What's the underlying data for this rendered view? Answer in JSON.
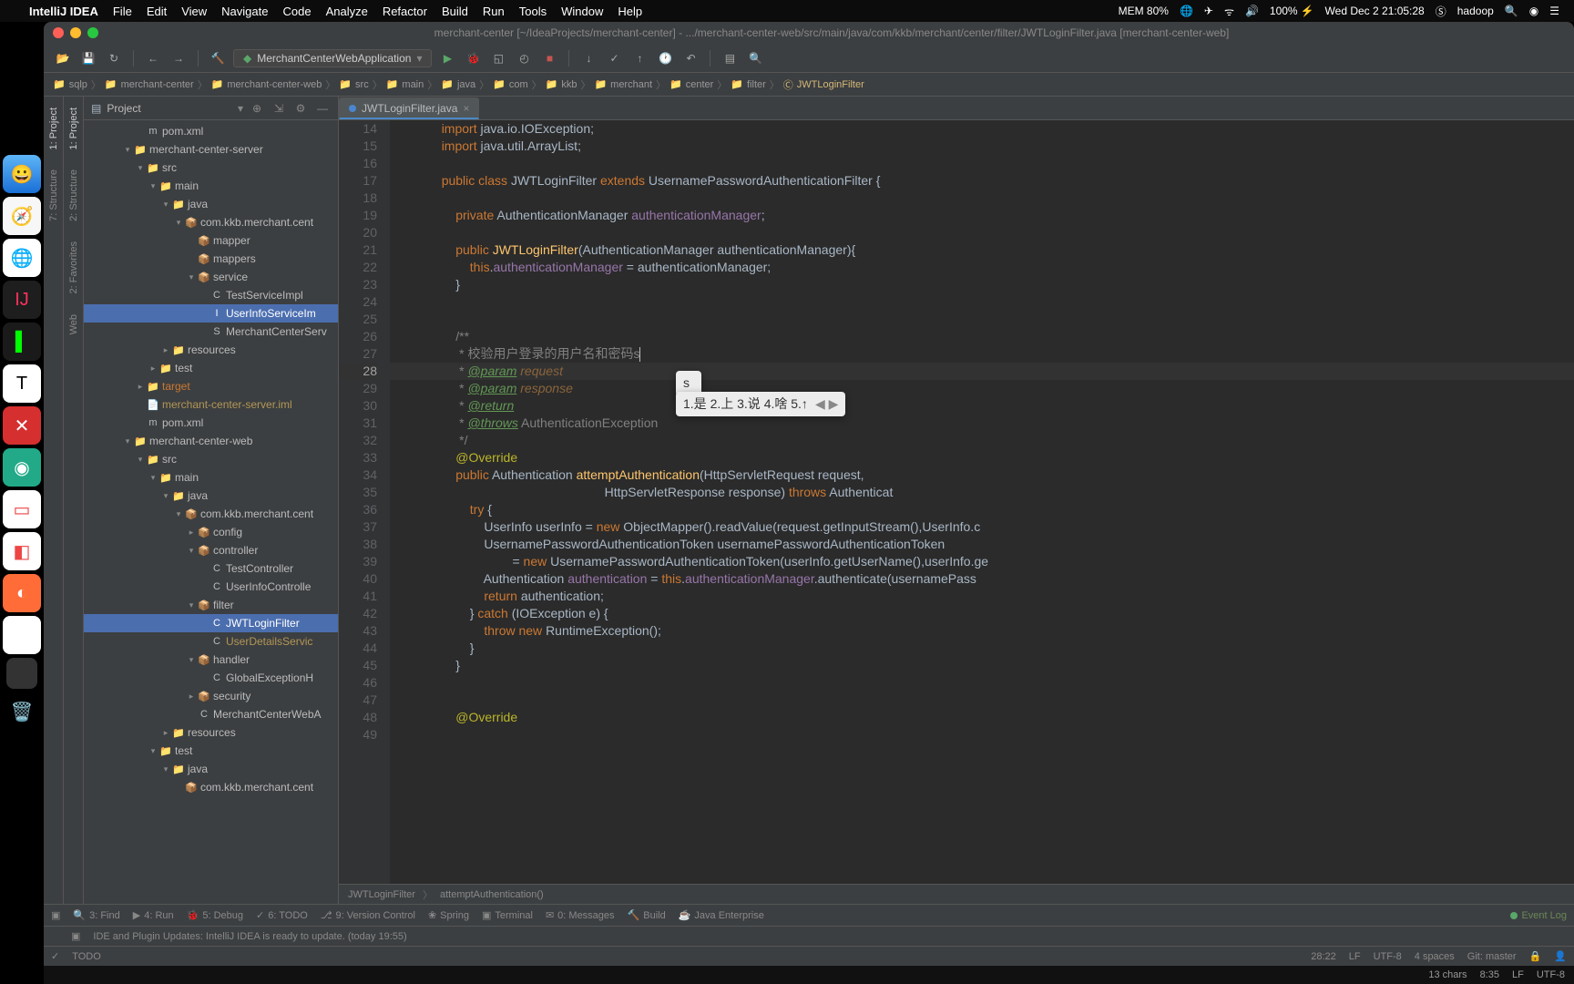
{
  "menubar": {
    "app": "IntelliJ IDEA",
    "items": [
      "File",
      "Edit",
      "View",
      "Navigate",
      "Code",
      "Analyze",
      "Refactor",
      "Build",
      "Run",
      "Tools",
      "Window",
      "Help"
    ],
    "status": {
      "mem": "MEM 80%",
      "battery": "100%",
      "date": "Wed Dec 2  21:05:28",
      "user": "hadoop"
    }
  },
  "window": {
    "title": "merchant-center [~/IdeaProjects/merchant-center] - .../merchant-center-web/src/main/java/com/kkb/merchant/center/filter/JWTLoginFilter.java [merchant-center-web]"
  },
  "toolbar": {
    "run_config": "MerchantCenterWebApplication"
  },
  "breadcrumb": [
    "sqlp",
    "merchant-center",
    "merchant-center-web",
    "src",
    "main",
    "java",
    "com",
    "kkb",
    "merchant",
    "center",
    "filter",
    "JWTLoginFilter"
  ],
  "project_panel": {
    "title": "Project"
  },
  "tree": [
    {
      "d": 4,
      "a": "",
      "i": "m",
      "t": "pom.xml",
      "cls": ""
    },
    {
      "d": 3,
      "a": "▾",
      "i": "📁",
      "t": "merchant-center-server",
      "cls": ""
    },
    {
      "d": 4,
      "a": "▾",
      "i": "📁",
      "t": "src",
      "cls": ""
    },
    {
      "d": 5,
      "a": "▾",
      "i": "📁",
      "t": "main",
      "cls": ""
    },
    {
      "d": 6,
      "a": "▾",
      "i": "📁",
      "t": "java",
      "cls": ""
    },
    {
      "d": 7,
      "a": "▾",
      "i": "📦",
      "t": "com.kkb.merchant.cent",
      "cls": ""
    },
    {
      "d": 8,
      "a": "",
      "i": "📦",
      "t": "mapper",
      "cls": ""
    },
    {
      "d": 8,
      "a": "",
      "i": "📦",
      "t": "mappers",
      "cls": ""
    },
    {
      "d": 8,
      "a": "▾",
      "i": "📦",
      "t": "service",
      "cls": ""
    },
    {
      "d": 9,
      "a": "",
      "i": "C",
      "t": "TestServiceImpl",
      "cls": ""
    },
    {
      "d": 9,
      "a": "",
      "i": "I",
      "t": "UserInfoServiceIm",
      "cls": "selected"
    },
    {
      "d": 9,
      "a": "",
      "i": "S",
      "t": "MerchantCenterServ",
      "cls": ""
    },
    {
      "d": 6,
      "a": "▸",
      "i": "📁",
      "t": "resources",
      "cls": ""
    },
    {
      "d": 5,
      "a": "▸",
      "i": "📁",
      "t": "test",
      "cls": ""
    },
    {
      "d": 4,
      "a": "▸",
      "i": "📁",
      "t": "target",
      "cls": "orange"
    },
    {
      "d": 4,
      "a": "",
      "i": "📄",
      "t": "merchant-center-server.iml",
      "cls": "yellow"
    },
    {
      "d": 4,
      "a": "",
      "i": "m",
      "t": "pom.xml",
      "cls": ""
    },
    {
      "d": 3,
      "a": "▾",
      "i": "📁",
      "t": "merchant-center-web",
      "cls": ""
    },
    {
      "d": 4,
      "a": "▾",
      "i": "📁",
      "t": "src",
      "cls": ""
    },
    {
      "d": 5,
      "a": "▾",
      "i": "📁",
      "t": "main",
      "cls": ""
    },
    {
      "d": 6,
      "a": "▾",
      "i": "📁",
      "t": "java",
      "cls": ""
    },
    {
      "d": 7,
      "a": "▾",
      "i": "📦",
      "t": "com.kkb.merchant.cent",
      "cls": ""
    },
    {
      "d": 8,
      "a": "▸",
      "i": "📦",
      "t": "config",
      "cls": ""
    },
    {
      "d": 8,
      "a": "▾",
      "i": "📦",
      "t": "controller",
      "cls": ""
    },
    {
      "d": 9,
      "a": "",
      "i": "C",
      "t": "TestController",
      "cls": ""
    },
    {
      "d": 9,
      "a": "",
      "i": "C",
      "t": "UserInfoControlle",
      "cls": ""
    },
    {
      "d": 8,
      "a": "▾",
      "i": "📦",
      "t": "filter",
      "cls": ""
    },
    {
      "d": 9,
      "a": "",
      "i": "C",
      "t": "JWTLoginFilter",
      "cls": "selected"
    },
    {
      "d": 9,
      "a": "",
      "i": "C",
      "t": "UserDetailsServic",
      "cls": "yellow"
    },
    {
      "d": 8,
      "a": "▾",
      "i": "📦",
      "t": "handler",
      "cls": ""
    },
    {
      "d": 9,
      "a": "",
      "i": "C",
      "t": "GlobalExceptionH",
      "cls": ""
    },
    {
      "d": 8,
      "a": "▸",
      "i": "📦",
      "t": "security",
      "cls": ""
    },
    {
      "d": 8,
      "a": "",
      "i": "C",
      "t": "MerchantCenterWebA",
      "cls": ""
    },
    {
      "d": 6,
      "a": "▸",
      "i": "📁",
      "t": "resources",
      "cls": ""
    },
    {
      "d": 5,
      "a": "▾",
      "i": "📁",
      "t": "test",
      "cls": ""
    },
    {
      "d": 6,
      "a": "▾",
      "i": "📁",
      "t": "java",
      "cls": ""
    },
    {
      "d": 7,
      "a": "",
      "i": "📦",
      "t": "com.kkb.merchant.cent",
      "cls": ""
    }
  ],
  "editor_tab": "JWTLoginFilter.java",
  "line_start": 14,
  "line_count": 36,
  "highlight_line": 28,
  "code_lines": [
    {
      "tokens": [
        [
          "",
          "            "
        ],
        [
          "kw",
          "import"
        ],
        [
          "",
          " java.io.IOException;"
        ]
      ]
    },
    {
      "tokens": [
        [
          "",
          "            "
        ],
        [
          "kw",
          "import"
        ],
        [
          "",
          " java.util.ArrayList;"
        ]
      ]
    },
    {
      "tokens": [
        [
          "",
          ""
        ]
      ]
    },
    {
      "tokens": [
        [
          "",
          "            "
        ],
        [
          "kw",
          "public class "
        ],
        [
          "cls",
          "JWTLoginFilter "
        ],
        [
          "kw",
          "extends "
        ],
        [
          "cls",
          "UsernamePasswordAuthenticationFilter {"
        ]
      ]
    },
    {
      "tokens": [
        [
          "",
          ""
        ]
      ]
    },
    {
      "tokens": [
        [
          "",
          "                "
        ],
        [
          "kw",
          "private "
        ],
        [
          "ty",
          "AuthenticationManager "
        ],
        [
          "fd",
          "authenticationManager"
        ],
        [
          "",
          ";"
        ]
      ]
    },
    {
      "tokens": [
        [
          "",
          ""
        ]
      ]
    },
    {
      "tokens": [
        [
          "",
          "                "
        ],
        [
          "kw",
          "public "
        ],
        [
          "fn",
          "JWTLoginFilter"
        ],
        [
          "",
          "(AuthenticationManager authenticationManager){"
        ]
      ]
    },
    {
      "tokens": [
        [
          "",
          "                    "
        ],
        [
          "kw",
          "this"
        ],
        [
          "",
          "."
        ],
        [
          "fd",
          "authenticationManager"
        ],
        [
          "",
          " = authenticationManager;"
        ]
      ]
    },
    {
      "tokens": [
        [
          "",
          "                }"
        ]
      ]
    },
    {
      "tokens": [
        [
          "",
          ""
        ]
      ]
    },
    {
      "tokens": [
        [
          "",
          ""
        ]
      ]
    },
    {
      "tokens": [
        [
          "",
          "                "
        ],
        [
          "cm",
          "/**"
        ]
      ]
    },
    {
      "tokens": [
        [
          "",
          "                 "
        ],
        [
          "cm",
          "* 校验用户登录的用户名和密码s"
        ]
      ],
      "caret": true
    },
    {
      "tokens": [
        [
          "",
          "                 "
        ],
        [
          "cm",
          "* "
        ],
        [
          "cm-tag",
          "@param"
        ],
        [
          "",
          " "
        ],
        [
          "cm-param",
          "request"
        ]
      ]
    },
    {
      "tokens": [
        [
          "",
          "                 "
        ],
        [
          "cm",
          "* "
        ],
        [
          "cm-tag",
          "@param"
        ],
        [
          "",
          " "
        ],
        [
          "cm-param",
          "response"
        ]
      ]
    },
    {
      "tokens": [
        [
          "",
          "                 "
        ],
        [
          "cm",
          "* "
        ],
        [
          "cm-tag",
          "@return"
        ]
      ]
    },
    {
      "tokens": [
        [
          "",
          "                 "
        ],
        [
          "cm",
          "* "
        ],
        [
          "cm-tag",
          "@throws"
        ],
        [
          "",
          " "
        ],
        [
          "cm",
          "AuthenticationException"
        ]
      ]
    },
    {
      "tokens": [
        [
          "",
          "                 "
        ],
        [
          "cm",
          "*/"
        ]
      ]
    },
    {
      "tokens": [
        [
          "",
          "                "
        ],
        [
          "ann",
          "@Override"
        ]
      ]
    },
    {
      "tokens": [
        [
          "",
          "                "
        ],
        [
          "kw",
          "public "
        ],
        [
          "ty",
          "Authentication "
        ],
        [
          "fn",
          "attemptAuthentication"
        ],
        [
          "",
          "(HttpServletRequest request,"
        ]
      ]
    },
    {
      "tokens": [
        [
          "",
          "                                                          HttpServletResponse response) "
        ],
        [
          "kw",
          "throws"
        ],
        [
          "",
          " Authenticat"
        ]
      ]
    },
    {
      "tokens": [
        [
          "",
          "                    "
        ],
        [
          "kw",
          "try "
        ],
        [
          "",
          "{"
        ]
      ]
    },
    {
      "tokens": [
        [
          "",
          "                        UserInfo userInfo = "
        ],
        [
          "kw",
          "new "
        ],
        [
          "",
          "ObjectMapper().readValue(request.getInputStream(),UserInfo.c"
        ]
      ]
    },
    {
      "tokens": [
        [
          "",
          "                        UsernamePasswordAuthenticationToken usernamePasswordAuthenticationToken"
        ]
      ]
    },
    {
      "tokens": [
        [
          "",
          "                                = "
        ],
        [
          "kw",
          "new "
        ],
        [
          "",
          "UsernamePasswordAuthenticationToken(userInfo.getUserName(),userInfo.ge"
        ]
      ]
    },
    {
      "tokens": [
        [
          "",
          "                        Authentication "
        ],
        [
          "fd",
          "authentication"
        ],
        [
          "",
          " = "
        ],
        [
          "kw",
          "this"
        ],
        [
          "",
          "."
        ],
        [
          "fd",
          "authenticationManager"
        ],
        [
          "",
          ".authenticate(usernamePass"
        ]
      ]
    },
    {
      "tokens": [
        [
          "",
          "                        "
        ],
        [
          "kw",
          "return "
        ],
        [
          "",
          "authentication;"
        ]
      ]
    },
    {
      "tokens": [
        [
          "",
          "                    } "
        ],
        [
          "kw",
          "catch "
        ],
        [
          "",
          "(IOException e) {"
        ]
      ]
    },
    {
      "tokens": [
        [
          "",
          "                        "
        ],
        [
          "kw",
          "throw new "
        ],
        [
          "",
          "RuntimeException();"
        ]
      ]
    },
    {
      "tokens": [
        [
          "",
          "                    }"
        ]
      ]
    },
    {
      "tokens": [
        [
          "",
          "                }"
        ]
      ]
    },
    {
      "tokens": [
        [
          "",
          ""
        ]
      ]
    },
    {
      "tokens": [
        [
          "",
          ""
        ]
      ]
    },
    {
      "tokens": [
        [
          "",
          "                "
        ],
        [
          "ann",
          "@Override"
        ]
      ]
    }
  ],
  "ime": {
    "input": "s",
    "candidates": "1.是  2.上  3.说  4.啥  5.↑",
    "nav": "◀ ▶"
  },
  "method_bc": [
    "JWTLoginFilter",
    "attemptAuthentication()"
  ],
  "bottom_tools": [
    "3: Find",
    "4: Run",
    "5: Debug",
    "6: TODO",
    "9: Version Control",
    "Spring",
    "Terminal",
    "0: Messages",
    "Build",
    "Java Enterprise"
  ],
  "event_log": "Event Log",
  "notify": "IDE and Plugin Updates: IntelliJ IDEA is ready to update. (today 19:55)",
  "status": {
    "todo": "TODO",
    "pos": "28:22",
    "lf": "LF",
    "enc": "UTF-8",
    "indent": "4 spaces",
    "git": "Git: master"
  },
  "info": {
    "chars": "13 chars",
    "time": "8:35",
    "lf2": "LF",
    "enc2": "UTF-8"
  },
  "left_tools": [
    "1: Project",
    "7: Structure",
    "2: Structure",
    "2: Favorites",
    "Web"
  ]
}
